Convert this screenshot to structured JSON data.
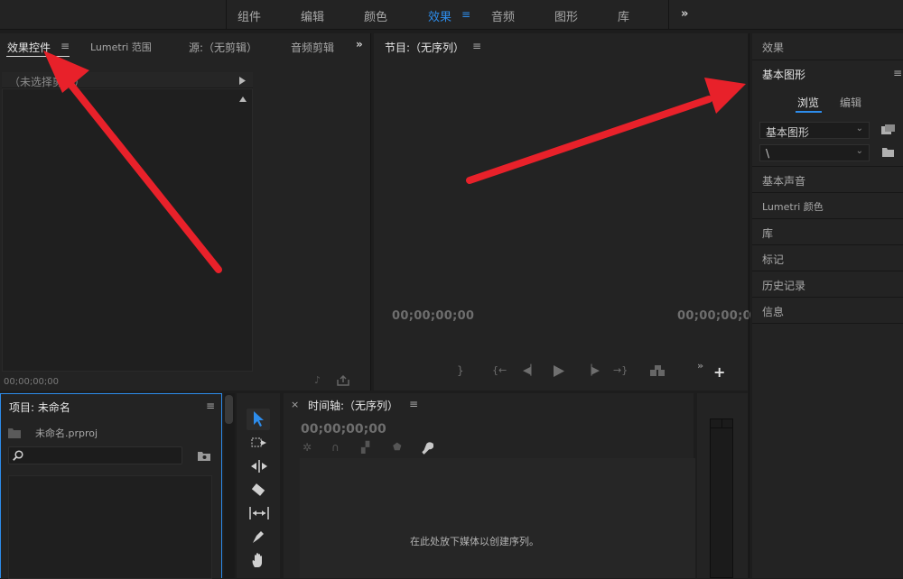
{
  "workspaces": [
    "组件",
    "编辑",
    "颜色",
    "效果",
    "音频",
    "图形",
    "库"
  ],
  "workspaces_active_index": 3,
  "workspace_more": "»",
  "effect_controls": {
    "tabs": [
      "效果控件",
      "Lumetri 范围",
      "源:（无剪辑）",
      "音频剪辑"
    ],
    "more": "»",
    "no_selection": "（未选择剪辑）",
    "timecode": "00;00;00;00"
  },
  "program_monitor": {
    "title": "节目:（无序列）",
    "timecode_left": "00;00;00;00",
    "timecode_right": "00;00;00;0",
    "more": "»"
  },
  "project_panel": {
    "title": "项目: 未命名",
    "file": "未命名.prproj"
  },
  "timeline": {
    "close": "×",
    "title": "时间轴:（无序列）",
    "timecode": "00;00;00;00",
    "empty_message": "在此处放下媒体以创建序列。"
  },
  "right_panel": {
    "effects": "效果",
    "essential_graphics": "基本图形",
    "tabs": [
      "浏览",
      "编辑"
    ],
    "dropdown1": "基本图形",
    "dropdown2": "\\",
    "rows": [
      "基本声音",
      "Lumetri 颜色",
      "库",
      "标记",
      "历史记录",
      "信息"
    ]
  },
  "menu_glyph": "≡",
  "colors": {
    "accent": "#2d8ceb",
    "arrow": "#e8212a"
  }
}
